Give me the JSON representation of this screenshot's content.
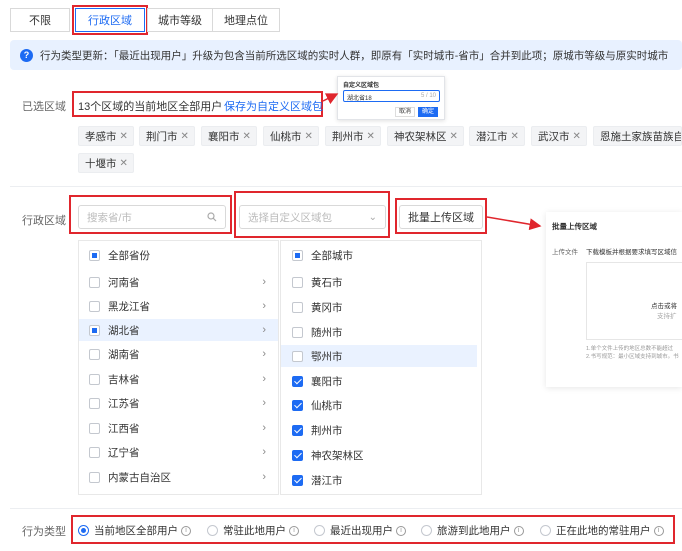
{
  "tabs": [
    {
      "label": "不限"
    },
    {
      "label": "行政区域"
    },
    {
      "label": "城市等级"
    },
    {
      "label": "地理点位"
    }
  ],
  "banner": {
    "icon": "?",
    "text": "行为类型更新：「最近出现用户」升级为包含当前所选区域的实时人群，即原有「实时城市-省市」合并到此项；原城市等级与原实时城市"
  },
  "selected": {
    "label": "已选区域",
    "summary": "13个区域的当前地区全部用户",
    "save_link": "保存为自定义区域包",
    "chips": [
      "孝感市",
      "荆门市",
      "襄阳市",
      "仙桃市",
      "荆州市",
      "神农架林区",
      "潜江市",
      "武汉市",
      "恩施土家族苗族自",
      "十堰市"
    ]
  },
  "popover": {
    "title": "自定义区域包",
    "input_value": "湖北省18",
    "counter": "5 / 10",
    "cancel": "取消",
    "confirm": "确定"
  },
  "region": {
    "label": "行政区域",
    "search_placeholder": "搜索省/市",
    "package_placeholder": "选择自定义区域包",
    "upload_button": "批量上传区域"
  },
  "provinces": {
    "header": "全部省份",
    "items": [
      "河南省",
      "黑龙江省",
      "湖北省",
      "湖南省",
      "吉林省",
      "江苏省",
      "江西省",
      "辽宁省",
      "内蒙古自治区"
    ]
  },
  "cities": {
    "header": "全部城市",
    "items": [
      {
        "name": "黄石市",
        "checked": false
      },
      {
        "name": "黄冈市",
        "checked": false
      },
      {
        "name": "随州市",
        "checked": false
      },
      {
        "name": "鄂州市",
        "checked": false
      },
      {
        "name": "襄阳市",
        "checked": true
      },
      {
        "name": "仙桃市",
        "checked": true
      },
      {
        "name": "荆州市",
        "checked": true
      },
      {
        "name": "神农架林区",
        "checked": true
      },
      {
        "name": "潜江市",
        "checked": true
      }
    ]
  },
  "upload_dialog": {
    "title": "批量上传区域",
    "file_label": "上传文件",
    "file_hint": "下载模板并根据要求填写区域信",
    "drop_text": "点击或将",
    "drop_sub": "支持扩",
    "note1": "1.单个文件上传的地区总数不能超过",
    "note2": "2.书写规范：最小区域支持到城市。书"
  },
  "behavior": {
    "label": "行为类型",
    "options": [
      {
        "label": "当前地区全部用户",
        "checked": true
      },
      {
        "label": "常驻此地用户",
        "checked": false
      },
      {
        "label": "最近出现用户",
        "checked": false
      },
      {
        "label": "旅游到此地用户",
        "checked": false
      },
      {
        "label": "正在此地的常驻用户",
        "checked": false
      }
    ]
  },
  "colors": {
    "accent": "#1d6bf3",
    "highlight": "#e0262d"
  }
}
